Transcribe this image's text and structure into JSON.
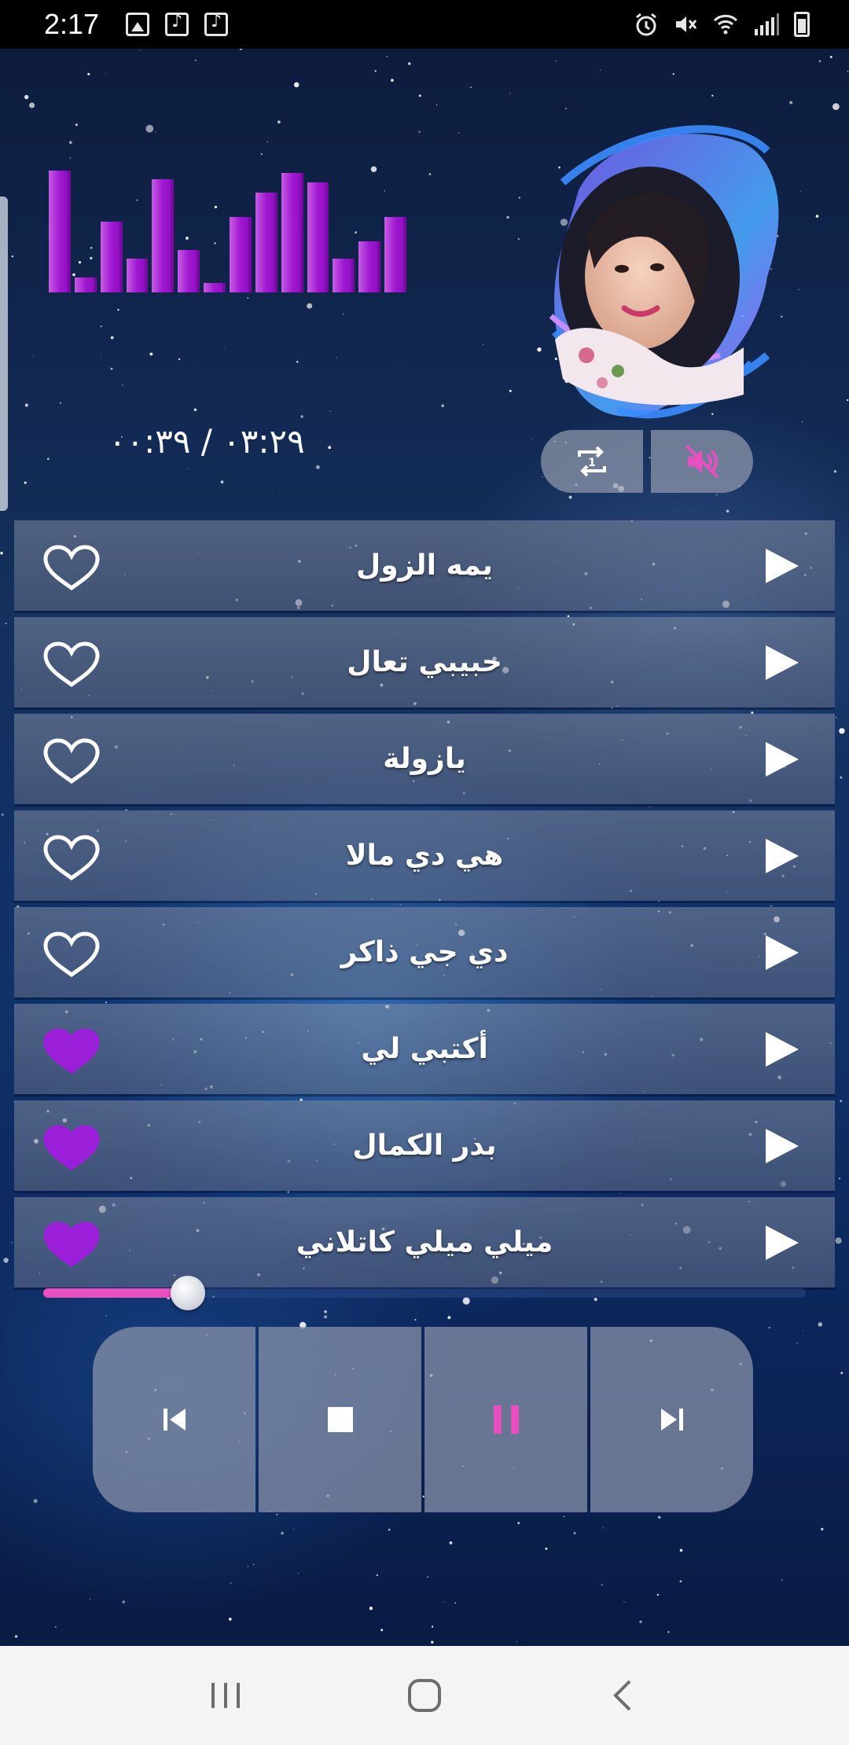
{
  "status_bar": {
    "time": "2:17",
    "left_icons": [
      "gallery-icon",
      "music-note-icon",
      "music-note-icon"
    ],
    "right_icons": [
      "alarm-icon",
      "mute-icon",
      "wifi-icon",
      "signal-icon",
      "battery-icon"
    ]
  },
  "player": {
    "time_display": "٠٣:٢٩ / ٠٠:٣٩",
    "visualizer_levels": [
      1.0,
      0.12,
      0.58,
      0.28,
      0.93,
      0.35,
      0.08,
      0.62,
      0.82,
      0.98,
      0.9,
      0.28,
      0.42,
      0.62
    ],
    "progress_fraction": 0.19,
    "controls": {
      "repeat_icon": "repeat-one-icon",
      "mute_icon": "volume-mute-icon"
    }
  },
  "songs": [
    {
      "title": "يمه الزول",
      "favorite": false
    },
    {
      "title": "حبيبي تعال",
      "favorite": false
    },
    {
      "title": "يازولة",
      "favorite": false
    },
    {
      "title": "هي دي مالا",
      "favorite": false
    },
    {
      "title": "دي جي ذاكر",
      "favorite": false
    },
    {
      "title": "أكتبي لي",
      "favorite": true
    },
    {
      "title": "بدر الكمال",
      "favorite": true
    },
    {
      "title": "ميلي ميلي كاتلاني",
      "favorite": true
    }
  ],
  "transport": [
    "previous-icon",
    "stop-icon",
    "pause-icon",
    "next-icon"
  ],
  "colors": {
    "accent_pink": "#e850c0",
    "favorite_purple": "#9b1fd9",
    "visualizer_purple": "#a018d0"
  },
  "nav_bar": [
    "recents-icon",
    "home-icon",
    "back-icon"
  ]
}
